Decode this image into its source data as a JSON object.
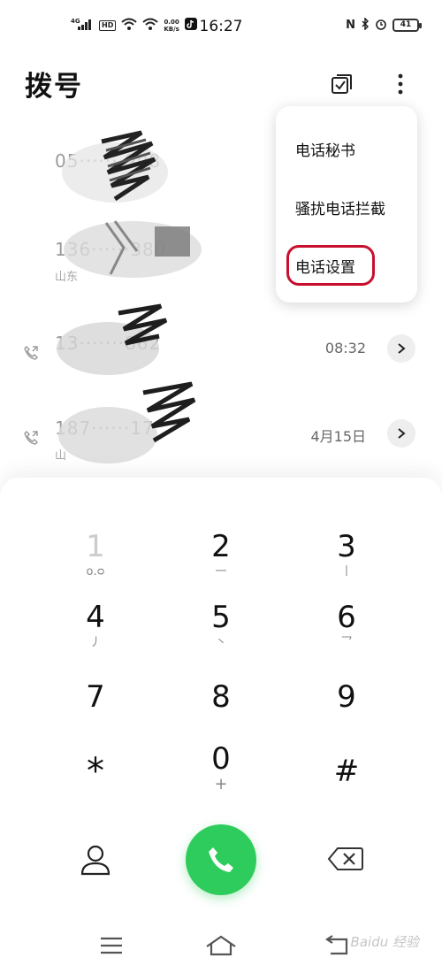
{
  "status_bar": {
    "network": "4G",
    "hd": "HD",
    "net_speed_value": "0.00",
    "net_speed_unit": "KB/s",
    "time": "16:27",
    "nfc": "N",
    "battery": "41"
  },
  "header": {
    "title": "拨号"
  },
  "call_log": [
    {
      "number": "05·······998",
      "location": "",
      "time": ""
    },
    {
      "number": "136······380",
      "location": "山东",
      "time": ""
    },
    {
      "number": "13·······862",
      "location": "",
      "time": "08:32"
    },
    {
      "number": "187······17",
      "location": "山",
      "time": "4月15日"
    }
  ],
  "menu": {
    "items": [
      "电话秘书",
      "骚扰电话拦截",
      "电话设置"
    ]
  },
  "dialpad": {
    "keys": [
      {
        "digit": "1",
        "sub": "ᴏ.ᴑ"
      },
      {
        "digit": "2",
        "sub": "一"
      },
      {
        "digit": "3",
        "sub": "丨"
      },
      {
        "digit": "4",
        "sub": "丿"
      },
      {
        "digit": "5",
        "sub": "丶"
      },
      {
        "digit": "6",
        "sub": "乛"
      },
      {
        "digit": "7",
        "sub": ""
      },
      {
        "digit": "8",
        "sub": ""
      },
      {
        "digit": "9",
        "sub": ""
      },
      {
        "digit": "*",
        "sub": ""
      },
      {
        "digit": "0",
        "sub": "+"
      },
      {
        "digit": "#",
        "sub": ""
      }
    ]
  },
  "watermark": "Baidu 经验",
  "colors": {
    "call_green": "#2ecc5c",
    "highlight_red": "#c8102e"
  }
}
